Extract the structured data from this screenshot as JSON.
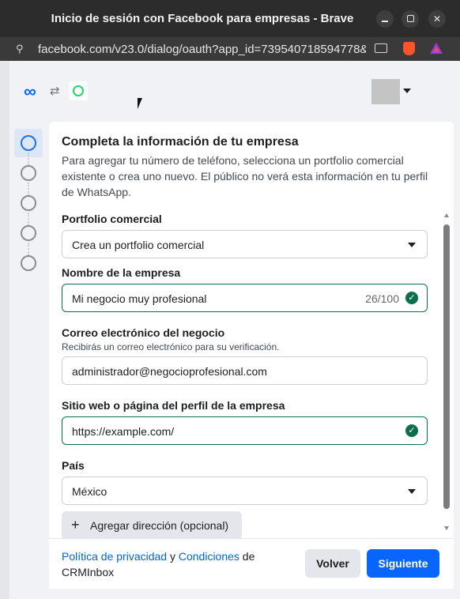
{
  "window": {
    "title": "Inicio de sesión con Facebook para empresas - Brave"
  },
  "browser": {
    "url": "facebook.com/v23.0/dialog/oauth?app_id=739540718594778&..."
  },
  "form": {
    "heading": "Completa la información de tu empresa",
    "intro": "Para agregar tu número de teléfono, selecciona un portfolio comercial existente o crea uno nuevo. El público no verá esta información en tu perfil de WhatsApp.",
    "portfolio": {
      "label": "Portfolio comercial",
      "value": "Crea un portfolio comercial"
    },
    "company_name": {
      "label": "Nombre de la empresa",
      "value": "Mi negocio muy profesional",
      "counter": "26/100"
    },
    "email": {
      "label": "Correo electrónico del negocio",
      "hint": "Recibirás un correo electrónico para su verificación.",
      "value": "administrador@negocioprofesional.com"
    },
    "website": {
      "label": "Sitio web o página del perfil de la empresa",
      "value": "https://example.com/"
    },
    "country": {
      "label": "País",
      "value": "México"
    },
    "add_address": "Agregar dirección (opcional)"
  },
  "footer": {
    "privacy_link": "Política de privacidad",
    "and_text": " y ",
    "terms_link": "Condiciones",
    "of_text": " de",
    "app_name": "CRMInbox",
    "back_button": "Volver",
    "next_button": "Siguiente"
  },
  "colors": {
    "accent": "#0866ff",
    "valid": "#0a6f4a"
  },
  "icons": {
    "meta": "meta-logo-icon",
    "swap": "swap-arrows-icon",
    "whatsapp": "whatsapp-icon",
    "check": "check-circle-icon"
  }
}
